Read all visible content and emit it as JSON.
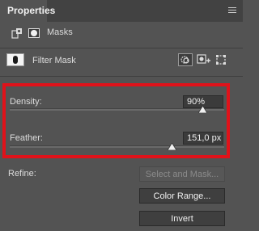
{
  "panel": {
    "tab_label": "Properties"
  },
  "modes": {
    "label": "Masks"
  },
  "mask": {
    "name": "Filter Mask"
  },
  "density": {
    "label": "Density:",
    "value": "90%",
    "level": 0.9
  },
  "feather": {
    "label": "Feather:",
    "value": "151,0 px",
    "level": 0.755
  },
  "refine": {
    "label": "Refine:",
    "buttons": {
      "select_and_mask": "Select and Mask...",
      "color_range": "Color Range...",
      "invert": "Invert"
    }
  },
  "colors": {
    "highlight_border": "#e0121a",
    "panel_bg": "#535353"
  }
}
